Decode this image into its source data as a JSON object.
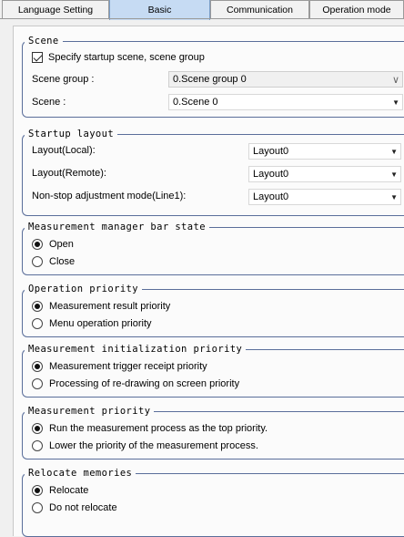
{
  "tabs": [
    {
      "label": "Language Setting",
      "active": false
    },
    {
      "label": "Basic",
      "active": true
    },
    {
      "label": "Communication",
      "active": false
    },
    {
      "label": "Operation mode",
      "active": false
    }
  ],
  "scene": {
    "title": "Scene",
    "checkbox_label": "Specify startup scene, scene group",
    "checked": true,
    "group_label": "Scene group :",
    "group_value": "0.Scene group 0",
    "scene_label": "Scene :",
    "scene_value": "0.Scene 0"
  },
  "startup_layout": {
    "title": "Startup layout",
    "local_label": "Layout(Local):",
    "local_value": "Layout0",
    "remote_label": "Layout(Remote):",
    "remote_value": "Layout0",
    "nonstop_label": "Non-stop adjustment mode(Line1):",
    "nonstop_value": "Layout0"
  },
  "bar_state": {
    "title": "Measurement manager bar state",
    "options": [
      "Open",
      "Close"
    ],
    "selected": 0
  },
  "operation_priority": {
    "title": "Operation priority",
    "options": [
      "Measurement result priority",
      "Menu operation priority"
    ],
    "selected": 0
  },
  "init_priority": {
    "title": "Measurement initialization priority",
    "options": [
      "Measurement trigger receipt priority",
      "Processing of re-drawing on screen priority"
    ],
    "selected": 0
  },
  "measurement_priority": {
    "title": "Measurement priority",
    "options": [
      "Run the measurement process as the top priority.",
      "Lower the priority of the measurement process."
    ],
    "selected": 0
  },
  "relocate": {
    "title": "Relocate memories",
    "options": [
      "Relocate",
      "Do not relocate"
    ],
    "selected": 0
  }
}
